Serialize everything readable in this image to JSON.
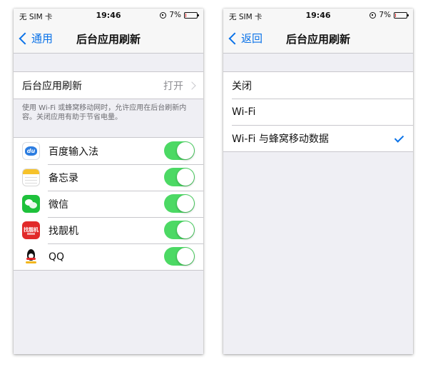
{
  "status_bar": {
    "carrier": "无 SIM 卡",
    "time": "19:46",
    "battery": "7%",
    "battery_level": 0.07
  },
  "left_screen": {
    "nav": {
      "back_label": "通用",
      "title": "后台应用刷新"
    },
    "setting_row": {
      "label": "后台应用刷新",
      "value": "打开"
    },
    "footnote": "使用 Wi-Fi 或蜂窝移动网时，允许应用在后台刷新内容。关闭应用有助于节省电量。",
    "apps": [
      {
        "name": "百度输入法",
        "icon": "baidu-input-icon",
        "enabled": true
      },
      {
        "name": "备忘录",
        "icon": "notes-icon",
        "enabled": true
      },
      {
        "name": "微信",
        "icon": "wechat-icon",
        "enabled": true
      },
      {
        "name": "找靓机",
        "icon": "zhaoliangji-icon",
        "icon_text": "找靓机",
        "enabled": true
      },
      {
        "name": "QQ",
        "icon": "qq-icon",
        "enabled": true
      }
    ]
  },
  "right_screen": {
    "nav": {
      "back_label": "返回",
      "title": "后台应用刷新"
    },
    "options": [
      {
        "label": "关闭",
        "selected": false
      },
      {
        "label": "Wi-Fi",
        "selected": false
      },
      {
        "label": "Wi-Fi 与蜂窝移动数据",
        "selected": true
      }
    ]
  },
  "colors": {
    "accent": "#0a72e8",
    "toggle_on": "#4cd964",
    "background": "#efeff4"
  }
}
